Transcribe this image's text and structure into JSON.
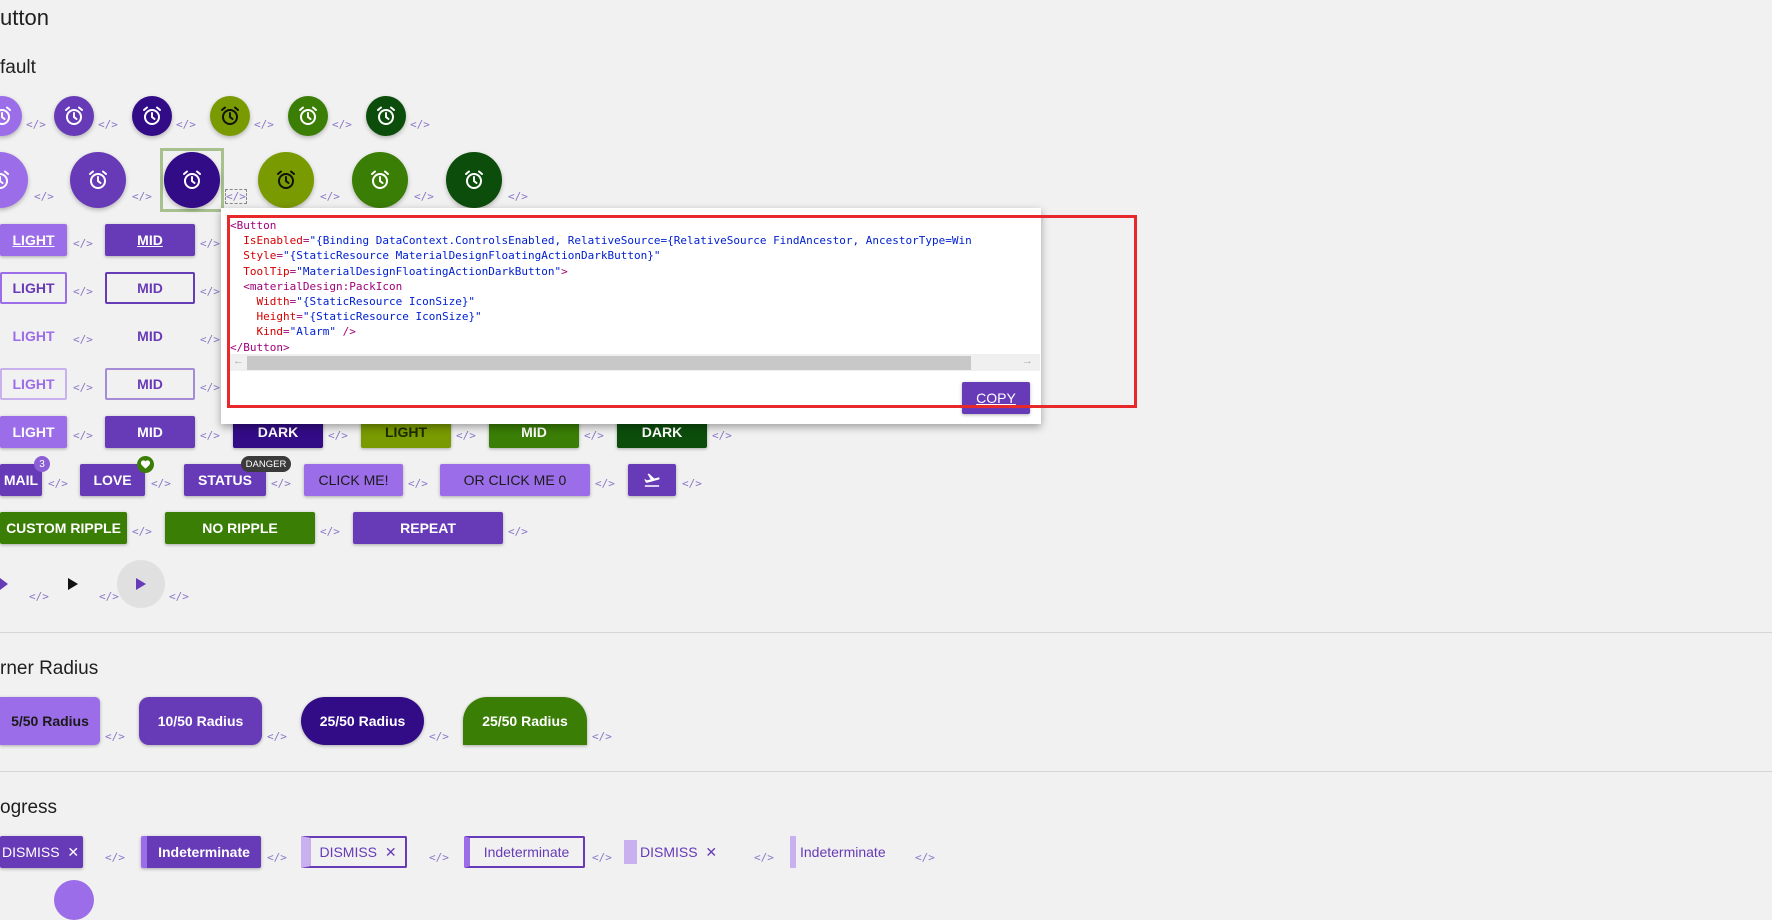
{
  "sections": {
    "button_title": "utton",
    "default_title": "fault",
    "corner_radius_title": "rner Radius",
    "progress_title": "ogress"
  },
  "code_glyph": "</>",
  "colors": {
    "light": "#9c6de8",
    "mid": "#673ab7",
    "dark": "#320b86",
    "green_light": "#7a9a01",
    "green_mid": "#3a7e06",
    "green_dark": "#0c4d0c",
    "code_icon": "#8a78c8",
    "highlight": "#e8292b"
  },
  "icons": {
    "alarm": "alarm-icon",
    "code": "code-icon",
    "play": "play-icon",
    "airplane": "airplane-takeoff-icon",
    "heart": "heart-icon",
    "close": "close-icon"
  },
  "raised_row": {
    "light": "LIGHT",
    "mid": "MID",
    "dark": "DARK",
    "green_light": "LIGHT",
    "green_mid": "MID",
    "green_dark": "DARK"
  },
  "outline_row": {
    "light": "LIGHT",
    "mid": "MID"
  },
  "flat_row": {
    "light": "LIGHT",
    "mid": "MID"
  },
  "outline_row2": {
    "light": "LIGHT",
    "mid": "MID"
  },
  "badge_row": {
    "mail": "MAIL",
    "mail_badge": "3",
    "love": "LOVE",
    "status": "STATUS",
    "status_badge": "DANGER",
    "click_me": "CLICK ME!",
    "or_click_me": "OR CLICK ME 0"
  },
  "ripple_row": {
    "custom": "CUSTOM RIPPLE",
    "none": "NO RIPPLE",
    "repeat": "REPEAT"
  },
  "corner_row": [
    "5/50 Radius",
    "10/50 Radius",
    "25/50 Radius",
    "25/50 Radius"
  ],
  "progress_row": {
    "dismiss1": "DISMISS",
    "indeterminate1": "Indeterminate",
    "dismiss2": "DISMISS",
    "indeterminate2": "Indeterminate",
    "dismiss3": "DISMISS",
    "indeterminate3": "Indeterminate",
    "close_glyph": "✕"
  },
  "popup": {
    "lines": [
      [
        [
          "tag",
          "<Button"
        ]
      ],
      [
        [
          "",
          "  "
        ],
        [
          "attr",
          "IsEnabled"
        ],
        [
          "tag",
          "="
        ],
        [
          "val",
          "\"{Binding DataContext.ControlsEnabled, RelativeSource={RelativeSource FindAncestor, AncestorType=Win"
        ]
      ],
      [
        [
          "",
          "  "
        ],
        [
          "attr",
          "Style"
        ],
        [
          "tag",
          "="
        ],
        [
          "val",
          "\"{StaticResource MaterialDesignFloatingActionDarkButton}\""
        ]
      ],
      [
        [
          "",
          "  "
        ],
        [
          "attr",
          "ToolTip"
        ],
        [
          "tag",
          "="
        ],
        [
          "val",
          "\"MaterialDesignFloatingActionDarkButton\""
        ],
        [
          "tag",
          ">"
        ]
      ],
      [
        [
          "",
          "  "
        ],
        [
          "tag",
          "<materialDesign:PackIcon"
        ]
      ],
      [
        [
          "",
          "    "
        ],
        [
          "attr",
          "Width"
        ],
        [
          "tag",
          "="
        ],
        [
          "val",
          "\"{StaticResource IconSize}\""
        ]
      ],
      [
        [
          "",
          "    "
        ],
        [
          "attr",
          "Height"
        ],
        [
          "tag",
          "="
        ],
        [
          "val",
          "\"{StaticResource IconSize}\""
        ]
      ],
      [
        [
          "",
          "    "
        ],
        [
          "attr",
          "Kind"
        ],
        [
          "tag",
          "="
        ],
        [
          "val",
          "\"Alarm\""
        ],
        [
          "tag",
          " />"
        ]
      ],
      [
        [
          "tag",
          "</Button>"
        ]
      ]
    ],
    "copy_label": "COPY",
    "scroll_left": "←",
    "scroll_right": "→"
  }
}
